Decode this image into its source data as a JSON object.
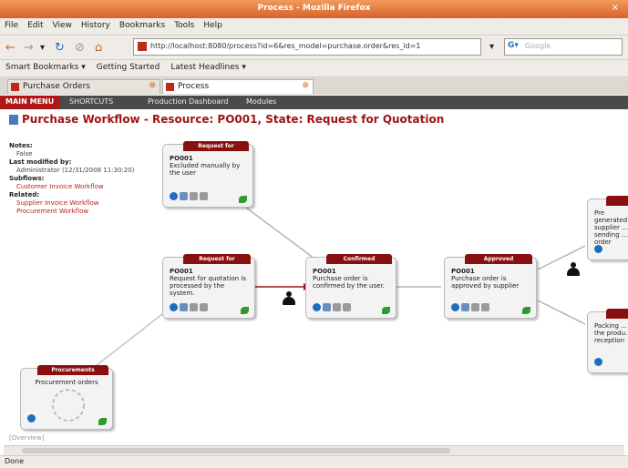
{
  "window": {
    "title": "Process - Mozilla Firefox",
    "close_glyph": "×"
  },
  "menu": [
    "File",
    "Edit",
    "View",
    "History",
    "Bookmarks",
    "Tools",
    "Help"
  ],
  "toolbar": {
    "back": "←",
    "forward": "→",
    "dropdown": "▾",
    "reload": "↻",
    "stop": "⊘",
    "home": "⌂",
    "url": "http://localhost:8080/process?id=6&res_model=purchase.order&res_id=1",
    "url_go": "▾",
    "search_engine": "G▾",
    "search_placeholder": "Google"
  },
  "bookmarks": [
    "Smart Bookmarks ▾",
    "Getting Started",
    "Latest Headlines ▾"
  ],
  "tabs": [
    {
      "label": "Purchase Orders",
      "close": "⊗"
    },
    {
      "label": "Process",
      "close": "⊗"
    }
  ],
  "appnav": {
    "main": "MAIN MENU",
    "items": [
      "SHORTCUTS",
      "Production Dashboard",
      "Modules"
    ]
  },
  "page": {
    "title": "Purchase Workflow - Resource: PO001, State: Request for Quotation"
  },
  "info": {
    "notes_label": "Notes:",
    "notes_value": "False",
    "modified_label": "Last modified by:",
    "modified_value": "Administrator (12/31/2008 11:30:20)",
    "subflows_label": "Subflows:",
    "subflows": [
      "Customer Invoice Workflow"
    ],
    "related_label": "Related:",
    "related": [
      "Supplier Invoice Workflow",
      "Procurement Workflow"
    ]
  },
  "nodes": {
    "cancelled": {
      "header": "Request for",
      "id": "PO001",
      "text": "Excluded manually by the user"
    },
    "rfq": {
      "header": "Request for",
      "id": "PO001",
      "text": "Request for quotation is processed by the system."
    },
    "confirmed": {
      "header": "Confirmed",
      "id": "PO001",
      "text": "Purchase order is confirmed by the user."
    },
    "approved": {
      "header": "Approved",
      "id": "PO001",
      "text": "Purchase order is approved by supplier"
    },
    "procurements": {
      "header": "Procurements",
      "text": "Procurement orders"
    },
    "right_top": {
      "text": "Pre generated supplier ... sending ... order"
    },
    "right_bottom": {
      "text": "Packing ... the produ... reception"
    }
  },
  "scroll_hint": "[Overview]",
  "status": {
    "text": "Done"
  },
  "colors": {
    "accent": "#a01414",
    "header": "#8a1010",
    "titlebar": "#d9622a"
  }
}
